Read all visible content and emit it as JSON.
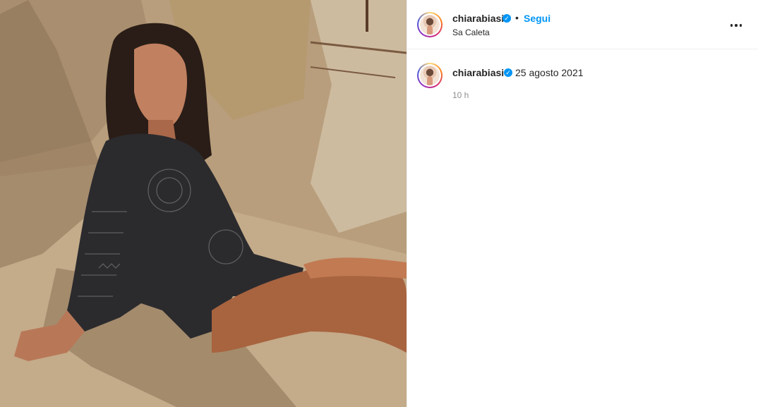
{
  "post": {
    "username": "chiarabiasi",
    "verified_glyph": "✓",
    "separator": "•",
    "follow_label": "Segui",
    "location": "Sa Caleta",
    "more_icon": "more-horizontal-icon",
    "caption": {
      "username": "chiarabiasi",
      "text": "25 agosto 2021",
      "time_ago": "10 h"
    }
  },
  "colors": {
    "link_blue": "#0095f6",
    "verified_blue": "#0095f6",
    "text_primary": "#262626",
    "text_secondary": "#8e8e8e",
    "divider": "#efefef"
  }
}
